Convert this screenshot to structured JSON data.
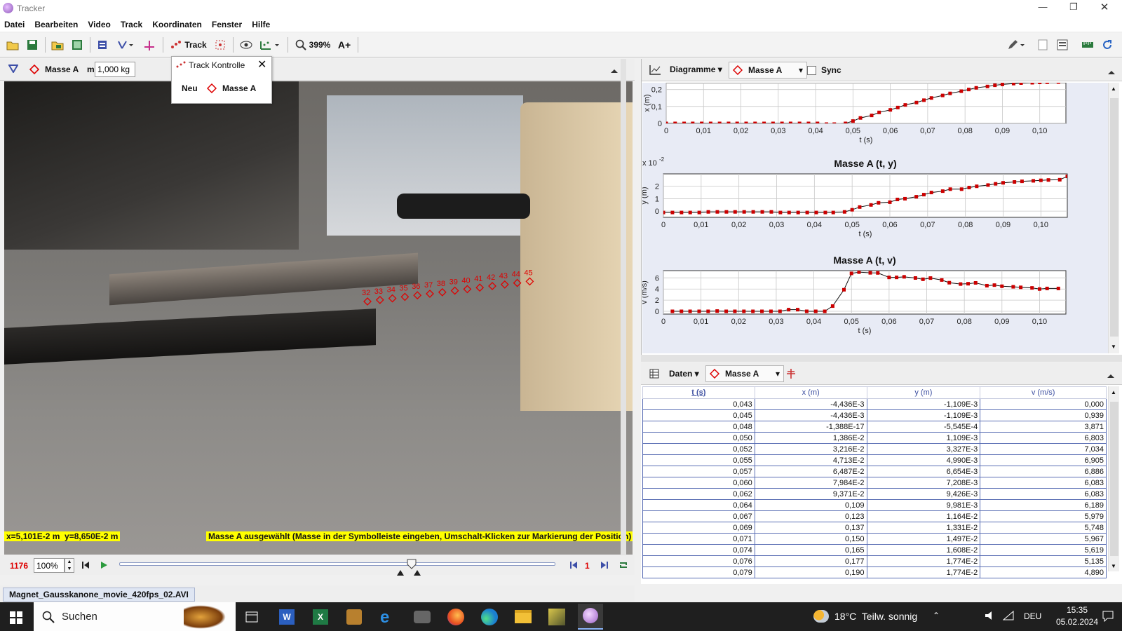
{
  "window": {
    "title": "Tracker",
    "controls": [
      "—",
      "❐",
      "✕"
    ]
  },
  "menu": [
    "Datei",
    "Bearbeiten",
    "Video",
    "Track",
    "Koordinaten",
    "Fenster",
    "Hilfe"
  ],
  "toolbar": {
    "track_label": "Track",
    "zoom_label": "399%",
    "font_label": "A+"
  },
  "track_bar": {
    "track_name": "Masse A",
    "mass_label": "m",
    "mass_value": "1,000 kg"
  },
  "track_popup": {
    "title": "Track Kontrolle",
    "new_label": "Neu",
    "track_name": "Masse A"
  },
  "video": {
    "point_labels": [
      "32",
      "33",
      "34",
      "35",
      "36",
      "37",
      "38",
      "39",
      "40",
      "41",
      "42",
      "43",
      "44",
      "45"
    ],
    "coords_readout": "x=5,101E-2 m  y=8,650E-2 m",
    "status_message": "Masse A ausgewählt (Masse in der Symbolleiste eingeben, Umschalt-Klicken zur Markierung der Position)"
  },
  "player": {
    "frame": "1176",
    "zoom": "100%",
    "step": "1",
    "slider_fraction": 0.67
  },
  "file_tab": "Magnet_Gausskanone_movie_420fps_02.AVI",
  "plot_toolbar": {
    "menu_label": "Diagramme",
    "track_name": "Masse A",
    "sync_label": "Sync"
  },
  "plots": {
    "tx": {
      "ylabel": "x (m)",
      "xlabel": "t (s)",
      "yticks": [
        "0,2",
        "0,1",
        "0"
      ]
    },
    "ty": {
      "title": "Masse A (t, y)",
      "ylabel": "y (m)",
      "xlabel": "t (s)",
      "yticks": [
        "2",
        "1",
        "0"
      ],
      "multiplier": "x 10",
      "multiplier_exp": "-2"
    },
    "tv": {
      "title": "Masse A (t, v)",
      "ylabel": "v (m/s)",
      "xlabel": "t (s)",
      "yticks": [
        "6",
        "4",
        "2",
        "0"
      ]
    },
    "xticks": [
      "0",
      "0,01",
      "0,02",
      "0,03",
      "0,04",
      "0,05",
      "0,06",
      "0,07",
      "0,08",
      "0,09",
      "0,10"
    ]
  },
  "chart_data": [
    {
      "type": "scatter",
      "title": "",
      "xlabel": "t (s)",
      "ylabel": "x (m)",
      "xlim": [
        0,
        0.107
      ],
      "ylim": [
        0,
        0.24
      ],
      "x": [
        0,
        0.0024,
        0.0048,
        0.0071,
        0.0095,
        0.0119,
        0.0143,
        0.0167,
        0.019,
        0.0214,
        0.0238,
        0.0262,
        0.0286,
        0.031,
        0.0333,
        0.0357,
        0.0381,
        0.0405,
        0.0429,
        0.045,
        0.048,
        0.05,
        0.052,
        0.055,
        0.057,
        0.06,
        0.062,
        0.064,
        0.067,
        0.069,
        0.071,
        0.074,
        0.076,
        0.079,
        0.081,
        0.083,
        0.086,
        0.088,
        0.09,
        0.093,
        0.095,
        0.098,
        0.1,
        0.102,
        0.105
      ],
      "y": [
        0,
        0,
        0,
        0,
        0,
        0,
        0,
        0,
        0,
        0,
        0,
        0,
        0,
        0,
        0,
        0,
        0,
        0,
        -0.0044,
        -0.0044,
        0,
        0.0139,
        0.0322,
        0.0471,
        0.0649,
        0.0798,
        0.0937,
        0.109,
        0.123,
        0.137,
        0.15,
        0.165,
        0.177,
        0.19,
        0.2,
        0.21,
        0.218,
        0.225,
        0.23,
        0.235,
        0.238,
        0.24,
        0.242,
        0.243,
        0.244
      ]
    },
    {
      "type": "scatter",
      "title": "Masse A (t, y)",
      "xlabel": "t (s)",
      "ylabel": "y (m)",
      "xlim": [
        0,
        0.107
      ],
      "ylim": [
        -0.005,
        0.03
      ],
      "x": [
        0,
        0.0024,
        0.0048,
        0.0071,
        0.0095,
        0.0119,
        0.0143,
        0.0167,
        0.019,
        0.0214,
        0.0238,
        0.0262,
        0.0286,
        0.031,
        0.0333,
        0.0357,
        0.0381,
        0.0405,
        0.0429,
        0.045,
        0.048,
        0.05,
        0.052,
        0.055,
        0.057,
        0.06,
        0.062,
        0.064,
        0.067,
        0.069,
        0.071,
        0.074,
        0.076,
        0.079,
        0.081,
        0.083,
        0.086,
        0.088,
        0.09,
        0.093,
        0.095,
        0.098,
        0.1,
        0.102,
        0.105,
        0.107
      ],
      "y": [
        -0.0011,
        -0.0011,
        -0.0011,
        -0.0011,
        -0.0011,
        -0.0006,
        -0.0006,
        -0.0006,
        -0.0006,
        -0.0006,
        -0.0006,
        -0.0006,
        -0.0006,
        -0.0011,
        -0.0011,
        -0.0011,
        -0.0011,
        -0.0011,
        -0.0011,
        -0.0011,
        -0.0006,
        0.0011,
        0.0033,
        0.005,
        0.0067,
        0.0072,
        0.0094,
        0.01,
        0.0116,
        0.0133,
        0.015,
        0.0161,
        0.0177,
        0.0177,
        0.019,
        0.02,
        0.021,
        0.022,
        0.0228,
        0.0235,
        0.024,
        0.0244,
        0.0248,
        0.0251,
        0.0253,
        0.028
      ]
    },
    {
      "type": "line",
      "title": "Masse A (t, v)",
      "xlabel": "t (s)",
      "ylabel": "v (m/s)",
      "xlim": [
        0,
        0.107
      ],
      "ylim": [
        -0.5,
        7.3
      ],
      "x": [
        0.0024,
        0.0048,
        0.0071,
        0.0095,
        0.0119,
        0.0143,
        0.0167,
        0.019,
        0.0214,
        0.0238,
        0.0262,
        0.0286,
        0.031,
        0.0333,
        0.0357,
        0.0381,
        0.0405,
        0.0429,
        0.045,
        0.048,
        0.05,
        0.052,
        0.055,
        0.057,
        0.06,
        0.062,
        0.064,
        0.067,
        0.069,
        0.071,
        0.074,
        0.076,
        0.079,
        0.081,
        0.083,
        0.086,
        0.088,
        0.09,
        0.093,
        0.095,
        0.098,
        0.1,
        0.102,
        0.105
      ],
      "y": [
        0,
        0,
        0,
        0,
        0,
        0.05,
        0,
        0,
        0,
        0,
        0,
        0,
        0,
        0.3,
        0.3,
        0,
        0,
        0,
        0.939,
        3.871,
        6.803,
        7.034,
        6.905,
        6.886,
        6.083,
        6.083,
        6.189,
        5.979,
        5.748,
        5.967,
        5.619,
        5.135,
        4.89,
        4.95,
        5.1,
        4.6,
        4.7,
        4.5,
        4.4,
        4.3,
        4.2,
        4.0,
        4.1,
        4.1
      ]
    }
  ],
  "data_toolbar": {
    "menu_label": "Daten",
    "track_name": "Masse A"
  },
  "table": {
    "columns": [
      "t (s)",
      "x (m)",
      "y (m)",
      "v (m/s)"
    ],
    "rows": [
      [
        "0,043",
        "-4,436E-3",
        "-1,109E-3",
        "0,000"
      ],
      [
        "0,045",
        "-4,436E-3",
        "-1,109E-3",
        "0,939"
      ],
      [
        "0,048",
        "-1,388E-17",
        "-5,545E-4",
        "3,871"
      ],
      [
        "0,050",
        "1,386E-2",
        "1,109E-3",
        "6,803"
      ],
      [
        "0,052",
        "3,216E-2",
        "3,327E-3",
        "7,034"
      ],
      [
        "0,055",
        "4,713E-2",
        "4,990E-3",
        "6,905"
      ],
      [
        "0,057",
        "6,487E-2",
        "6,654E-3",
        "6,886"
      ],
      [
        "0,060",
        "7,984E-2",
        "7,208E-3",
        "6,083"
      ],
      [
        "0,062",
        "9,371E-2",
        "9,426E-3",
        "6,083"
      ],
      [
        "0,064",
        "0,109",
        "9,981E-3",
        "6,189"
      ],
      [
        "0,067",
        "0,123",
        "1,164E-2",
        "5,979"
      ],
      [
        "0,069",
        "0,137",
        "1,331E-2",
        "5,748"
      ],
      [
        "0,071",
        "0,150",
        "1,497E-2",
        "5,967"
      ],
      [
        "0,074",
        "0,165",
        "1,608E-2",
        "5,619"
      ],
      [
        "0,076",
        "0,177",
        "1,774E-2",
        "5,135"
      ],
      [
        "0,079",
        "0,190",
        "1,774E-2",
        "4,890"
      ]
    ]
  },
  "taskbar": {
    "search_label": "Suchen",
    "weather": "18°C  Teilw. sonnig",
    "lang": "DEU",
    "time": "15:35",
    "date": "05.02.2024"
  },
  "colors": {
    "accent_red": "#cc0000",
    "status_yellow": "#ffff00",
    "taskbar": "#1f1f1f",
    "plot_bg": "#e8ebf5"
  }
}
